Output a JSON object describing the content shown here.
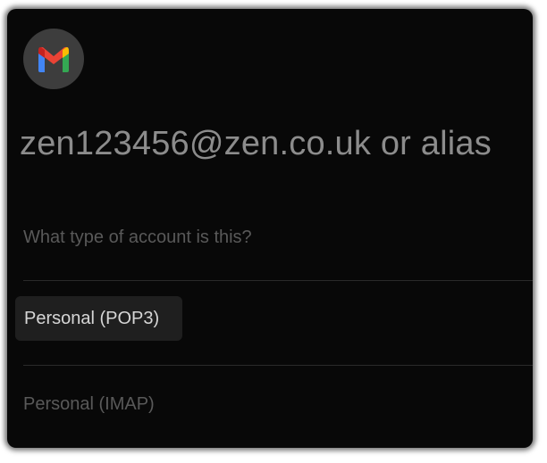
{
  "app": {
    "logo_icon": "gmail-logo-icon"
  },
  "header": {
    "email": "zen123456@zen.co.uk or alias"
  },
  "form": {
    "question": "What type of account is this?",
    "options": [
      {
        "label": "Personal (POP3)",
        "selected": true
      },
      {
        "label": "Personal (IMAP)",
        "selected": false
      }
    ]
  },
  "colors": {
    "background": "#080808",
    "gmail_red": "#EA4335",
    "gmail_blue": "#4285F4",
    "gmail_green": "#34A853",
    "gmail_yellow": "#FBBC04"
  }
}
